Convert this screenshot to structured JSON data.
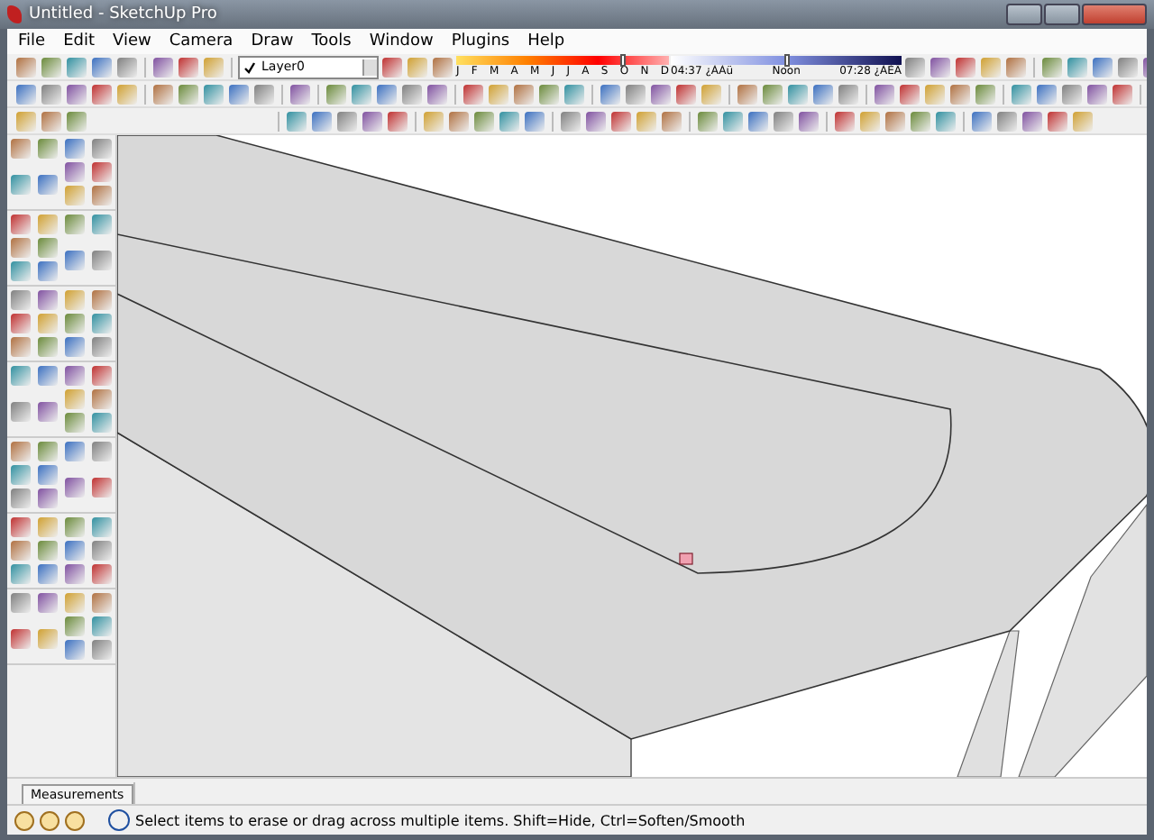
{
  "window": {
    "title": "Untitled - SketchUp Pro"
  },
  "menu": [
    "File",
    "Edit",
    "View",
    "Camera",
    "Draw",
    "Tools",
    "Window",
    "Plugins",
    "Help"
  ],
  "layer": {
    "value": "Layer0",
    "checked": true
  },
  "shadows": {
    "month_slider": {
      "level": 0.78
    },
    "time_slider": {
      "level": 0.5
    },
    "months": [
      "J",
      "F",
      "M",
      "A",
      "M",
      "J",
      "J",
      "A",
      "S",
      "O",
      "N",
      "D"
    ],
    "times": [
      "04:37 ¿ÀÀü",
      "Noon",
      "07:28 ¿ÀÈÄ"
    ]
  },
  "measurements": {
    "label": "Measurements"
  },
  "status_bar": {
    "text": "Select items to erase or drag across multiple items. Shift=Hide, Ctrl=Soften/Smooth"
  }
}
